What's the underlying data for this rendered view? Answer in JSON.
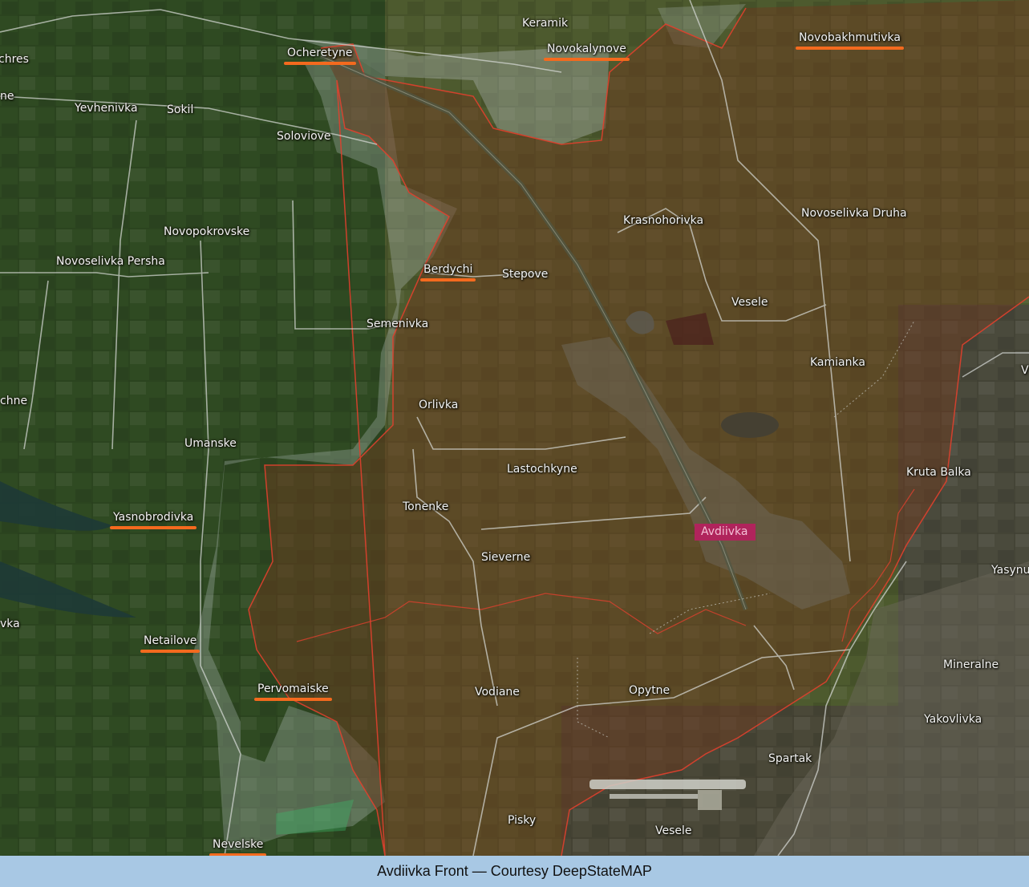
{
  "caption": "Avdiivka Front — Courtesy DeepStateMAP",
  "colors": {
    "occupied_fill": "#6b3a1e",
    "occupied_border": "#e0402e",
    "grey_zone_fill": "#b9c4c4",
    "highlight_underline": "#f46a1e",
    "city_badge": "#b0245c",
    "caption_background": "#a8c8e4"
  },
  "places": {
    "chres": "chres",
    "ne": "ne",
    "yevhenivka": "Yevhenivka",
    "sokil": "Sokil",
    "ocheretyne": "Ocheretyne",
    "keramik": "Keramik",
    "novokalynove": "Novokalynove",
    "novobakhmutivka": "Novobakhmutivka",
    "soloviove": "Soloviove",
    "novopokrovske": "Novopokrovske",
    "novoselivka_persha": "Novoselivka Persha",
    "krasnohorivka": "Krasnohorivka",
    "novoselivka_druha": "Novoselivka Druha",
    "berdychi": "Berdychi",
    "stepove": "Stepove",
    "vesele_north": "Vesele",
    "semenivka": "Semenivka",
    "kamianka": "Kamianka",
    "v_edge": "V",
    "chne": "chne",
    "orlivka": "Orlivka",
    "umanske": "Umanske",
    "lastochkyne": "Lastochkyne",
    "kruta_balka": "Kruta Balka",
    "tonenke": "Tonenke",
    "yasnobrodivka": "Yasnobrodivka",
    "avdiivka": "Avdiivka",
    "sieverne": "Sieverne",
    "yasynu": "Yasynu",
    "vka": "vka",
    "netailove": "Netailove",
    "mineralne": "Mineralne",
    "pervomaiske": "Pervomaiske",
    "vodiane": "Vodiane",
    "opytne": "Opytne",
    "yakovlivka": "Yakovlivka",
    "spartak": "Spartak",
    "pisky": "Pisky",
    "vesele_south": "Vesele",
    "nevelske": "Nevelske"
  },
  "highlighted_places": [
    "Ocheretyne",
    "Novokalynove",
    "Novobakhmutivka",
    "Berdychi",
    "Yasnobrodivka",
    "Netailove",
    "Pervomaiske",
    "Nevelske"
  ],
  "marked_city": "Avdiivka"
}
